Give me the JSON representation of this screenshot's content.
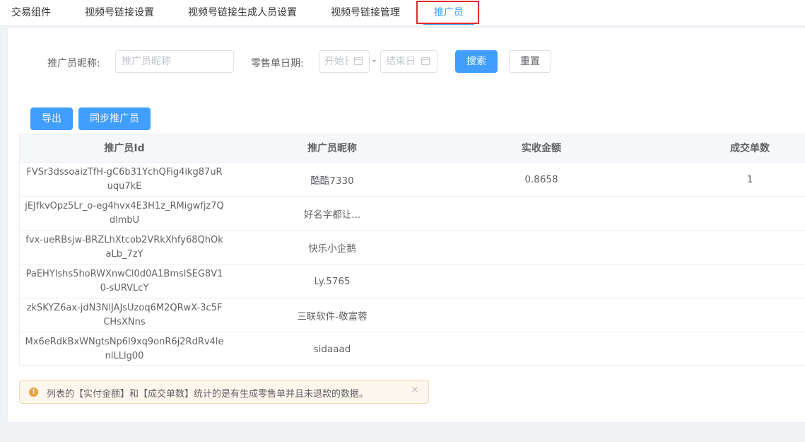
{
  "tabs": [
    {
      "label": "交易组件"
    },
    {
      "label": "视频号链接设置"
    },
    {
      "label": "视频号链接生成人员设置"
    },
    {
      "label": "视频号链接管理"
    },
    {
      "label": "推广员"
    }
  ],
  "filters": {
    "nickname_label": "推广员昵称:",
    "nickname_placeholder": "推广员昵称",
    "date_label": "零售单日期:",
    "start_placeholder": "开始日期",
    "end_placeholder": "结束日期",
    "date_separator": "-",
    "search_label": "搜索",
    "reset_label": "重置"
  },
  "actions": {
    "export_label": "导出",
    "sync_label": "同步推广员"
  },
  "table": {
    "columns": [
      "推广员Id",
      "推广员昵称",
      "实收金额",
      "成交单数"
    ],
    "rows": [
      {
        "id": "FVSr3dssoaizTfH-gC6b31YchQFig4ikg87uRuqu7kE",
        "nickname": "酷酷7330",
        "amount": "0.8658",
        "orders": "1"
      },
      {
        "id": "jEJfkvOpz5Lr_o-eg4hvx4E3H1z_RMigwfjz7QdlmbU",
        "nickname": "好名字都让...",
        "amount": "",
        "orders": ""
      },
      {
        "id": "fvx-ueRBsjw-BRZLhXtcob2VRkXhfy68QhOkaLb_7zY",
        "nickname": "快乐小企鹅",
        "amount": "",
        "orders": ""
      },
      {
        "id": "PaEHYlshs5hoRWXnwCl0d0A1BmslSEG8V10-sURVLcY",
        "nickname": "Ly.5765",
        "amount": "",
        "orders": ""
      },
      {
        "id": "zkSKYZ6ax-jdN3NlJAJsUzoq6M2QRwX-3c5FCHsXNns",
        "nickname": "三联软件-敬富蓉",
        "amount": "",
        "orders": ""
      },
      {
        "id": "Mx6eRdkBxWNgtsNp6l9xq9onR6j2RdRv4lenlLLlg00",
        "nickname": "sidaaad",
        "amount": "",
        "orders": ""
      }
    ]
  },
  "alert": {
    "icon": "warning-icon",
    "text": "列表的【实付金额】和【成交单数】统计的是有生成零售单并且未退款的数据。",
    "close_icon": "close-icon"
  }
}
